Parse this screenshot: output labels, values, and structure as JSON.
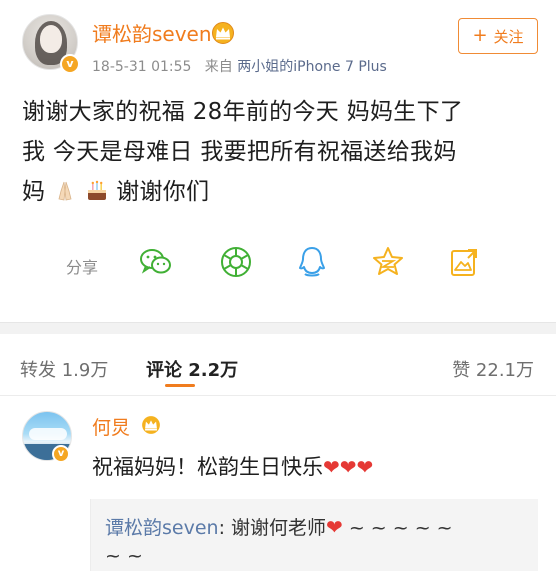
{
  "post": {
    "author": "谭松韵seven",
    "timestamp": "18-5-31 01:55",
    "source_prefix": "来自",
    "source_device": "两小姐的iPhone 7 Plus",
    "follow_label": "关注",
    "text_line1": "谢谢大家的祝福 28年前的今天 妈妈生下了",
    "text_line2": "我  今天是母难日 我要把所有祝福送给我妈",
    "text_line3a": "妈",
    "text_line3b": "谢谢你们",
    "verified_mark": "v"
  },
  "share": {
    "label": "分享",
    "icons": [
      "wechat-icon",
      "moments-icon",
      "qq-icon",
      "qzone-icon",
      "image-share-icon"
    ]
  },
  "tabs": {
    "repost_label": "转发",
    "repost_count": "1.9万",
    "comments_label": "评论",
    "comments_count": "2.2万",
    "likes_label": "赞",
    "likes_count": "22.1万"
  },
  "comment": {
    "author": "何炅",
    "text": "祝福妈妈！松韵生日快乐",
    "hearts": "❤❤❤",
    "verified_mark": "v",
    "reply_author": "谭松韵seven",
    "reply_text": ": 谢谢何老师",
    "reply_heart": "❤",
    "reply_tail_line1": " ~ ~ ~ ~ ~",
    "reply_tail_line2": "~ ~"
  },
  "colors": {
    "brand_orange": "#f07c1e",
    "link_blue": "#5b7aa8",
    "muted_gray": "#8c8c8c"
  }
}
